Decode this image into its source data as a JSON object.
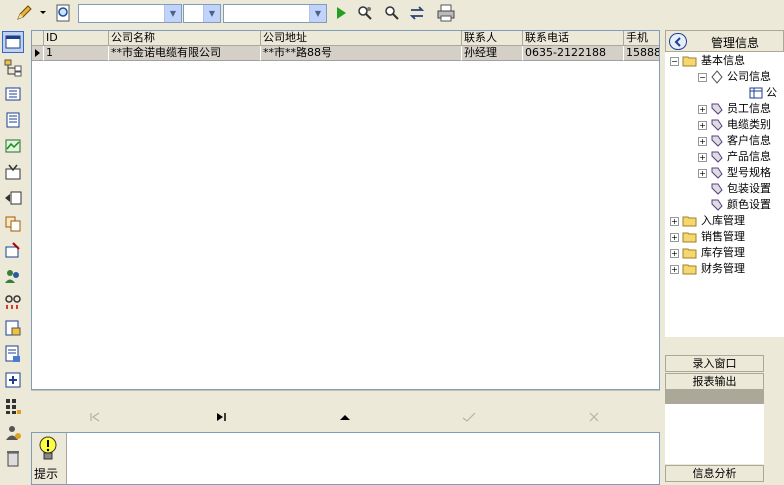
{
  "toolbar": {
    "combo_box_1": "",
    "combo_box_2": "",
    "combo_box_3": ""
  },
  "grid": {
    "columns": [
      "ID",
      "公司名称",
      "公司地址",
      "联系人",
      "联系电话",
      "手机"
    ],
    "rows": [
      [
        "1",
        "**市金诺电缆有限公司",
        "**市**路88号",
        "孙经理",
        "0635-2122188",
        "15888"
      ]
    ]
  },
  "hint": {
    "label": "提示"
  },
  "right_panel": {
    "title": "管理信息",
    "tree": {
      "root": "基本信息",
      "company_info": "公司信息",
      "company_leaf": "公",
      "children": [
        "员工信息",
        "电缆类别",
        "客户信息",
        "产品信息",
        "型号规格",
        "包装设置",
        "颜色设置"
      ],
      "top_level": [
        "入库管理",
        "销售管理",
        "库存管理",
        "财务管理"
      ]
    },
    "buttons": {
      "entry_window": "录入窗口",
      "report_output": "报表输出",
      "info_analysis": "信息分析"
    }
  }
}
